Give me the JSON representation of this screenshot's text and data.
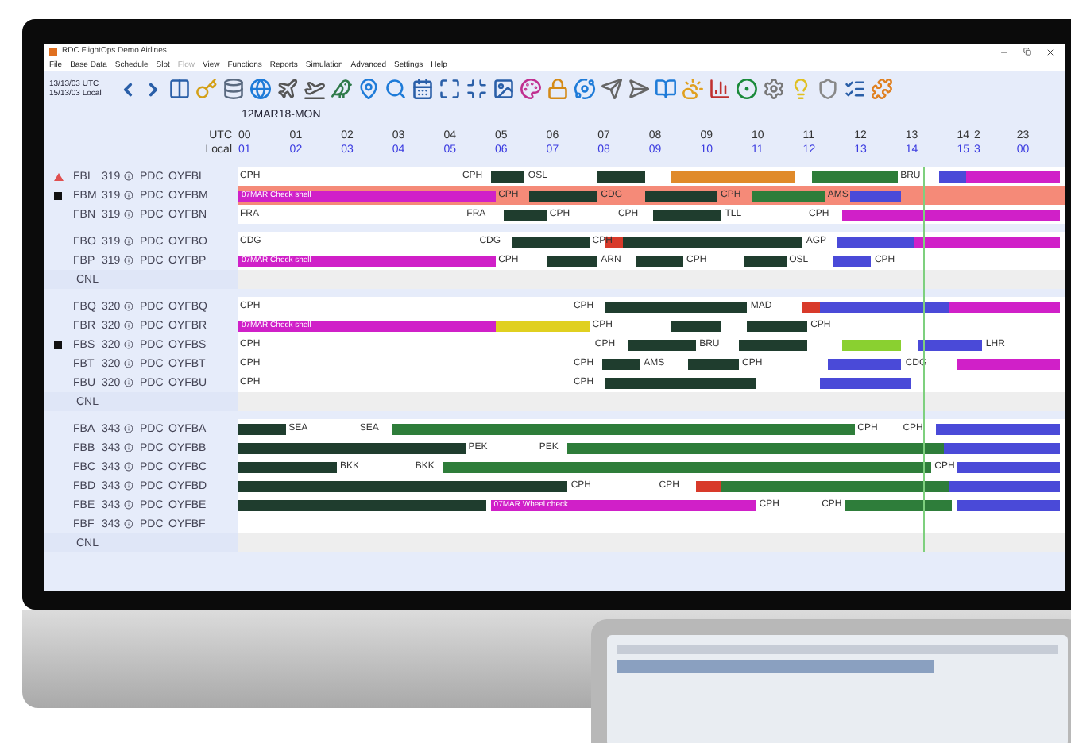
{
  "window": {
    "title": "RDC FlightOps Demo Airlines"
  },
  "menu": [
    {
      "label": "File",
      "disabled": false
    },
    {
      "label": "Base Data",
      "disabled": false
    },
    {
      "label": "Schedule",
      "disabled": false
    },
    {
      "label": "Slot",
      "disabled": false
    },
    {
      "label": "Flow",
      "disabled": true
    },
    {
      "label": "View",
      "disabled": false
    },
    {
      "label": "Functions",
      "disabled": false
    },
    {
      "label": "Reports",
      "disabled": false
    },
    {
      "label": "Simulation",
      "disabled": false
    },
    {
      "label": "Advanced",
      "disabled": false
    },
    {
      "label": "Settings",
      "disabled": false
    },
    {
      "label": "Help",
      "disabled": false
    }
  ],
  "clock": {
    "utc": "13/13/03 UTC",
    "local": "15/13/03 Local"
  },
  "date": "12MAR18-MON",
  "timeline": {
    "utc_label": "UTC",
    "local_label": "Local",
    "ticks": [
      {
        "utc": "00",
        "local": "01"
      },
      {
        "utc": "01",
        "local": "02"
      },
      {
        "utc": "02",
        "local": "03"
      },
      {
        "utc": "03",
        "local": "04"
      },
      {
        "utc": "04",
        "local": "05"
      },
      {
        "utc": "05",
        "local": "06"
      },
      {
        "utc": "06",
        "local": "07"
      },
      {
        "utc": "07",
        "local": "08"
      },
      {
        "utc": "08",
        "local": "09"
      },
      {
        "utc": "09",
        "local": "10"
      },
      {
        "utc": "10",
        "local": "11"
      },
      {
        "utc": "11",
        "local": "12"
      },
      {
        "utc": "12",
        "local": "13"
      },
      {
        "utc": "13",
        "local": "14"
      },
      {
        "utc": "14",
        "local": "15"
      },
      {
        "utc": "2",
        "local": "3"
      },
      {
        "utc": "23",
        "local": "00"
      }
    ]
  },
  "groups": [
    {
      "rows": [
        {
          "kind": "aircraft",
          "reg": "FBL",
          "type": "319",
          "base": "PDC",
          "code": "OYFBL",
          "alert": true,
          "flag": false,
          "highlight": false,
          "segments": [
            {
              "color": "#1f3d2e"
            },
            {
              "color": "#1f3d2e"
            },
            {
              "color": "#e08a2a"
            },
            {
              "color": "#2e7d3a"
            },
            {
              "color": "#4a4ad8"
            },
            {
              "color": "#d020c8"
            }
          ],
          "stations": [
            "CPH",
            "CPH",
            "OSL",
            "BRU"
          ]
        },
        {
          "kind": "aircraft",
          "reg": "FBM",
          "type": "319",
          "base": "PDC",
          "code": "OYFBM",
          "alert": false,
          "flag": true,
          "highlight": true,
          "segments": [
            {
              "color": "#d020c8",
              "text": "07MAR Check shell"
            },
            {
              "color": "#1f3d2e"
            },
            {
              "color": "#1f3d2e"
            },
            {
              "color": "#2e7d3a"
            },
            {
              "color": "#4a4ad8"
            }
          ],
          "stations": [
            "CPH",
            "CDG",
            "CPH",
            "AMS"
          ]
        },
        {
          "kind": "aircraft",
          "reg": "FBN",
          "type": "319",
          "base": "PDC",
          "code": "OYFBN",
          "alert": false,
          "flag": false,
          "highlight": false,
          "segments": [
            {
              "color": "#1f3d2e"
            },
            {
              "color": "#1f3d2e"
            },
            {
              "color": "#d020c8"
            }
          ],
          "stations": [
            "FRA",
            "FRA",
            "CPH",
            "CPH",
            "TLL",
            "CPH"
          ]
        }
      ]
    },
    {
      "rows": [
        {
          "kind": "aircraft",
          "reg": "FBO",
          "type": "319",
          "base": "PDC",
          "code": "OYFBO",
          "alert": false,
          "flag": false,
          "highlight": false,
          "segments": [
            {
              "color": "#1f3d2e"
            },
            {
              "color": "#d83a2a"
            },
            {
              "color": "#1f3d2e"
            },
            {
              "color": "#4a4ad8"
            },
            {
              "color": "#d020c8"
            }
          ],
          "stations": [
            "CDG",
            "CDG",
            "CPH",
            "AGP"
          ]
        },
        {
          "kind": "aircraft",
          "reg": "FBP",
          "type": "319",
          "base": "PDC",
          "code": "OYFBP",
          "alert": false,
          "flag": false,
          "highlight": false,
          "segments": [
            {
              "color": "#d020c8",
              "text": "07MAR Check shell"
            },
            {
              "color": "#1f3d2e"
            },
            {
              "color": "#1f3d2e"
            },
            {
              "color": "#1f3d2e"
            },
            {
              "color": "#4a4ad8"
            }
          ],
          "stations": [
            "CPH",
            "ARN",
            "CPH",
            "OSL",
            "CPH"
          ]
        },
        {
          "kind": "cancelled",
          "label": "CNL"
        }
      ]
    },
    {
      "rows": [
        {
          "kind": "aircraft",
          "reg": "FBQ",
          "type": "320",
          "base": "PDC",
          "code": "OYFBQ",
          "alert": false,
          "flag": false,
          "highlight": false,
          "segments": [
            {
              "color": "#1f3d2e"
            },
            {
              "color": "#d83a2a"
            },
            {
              "color": "#4a4ad8"
            },
            {
              "color": "#d020c8"
            }
          ],
          "stations": [
            "CPH",
            "CPH",
            "MAD"
          ]
        },
        {
          "kind": "aircraft",
          "reg": "FBR",
          "type": "320",
          "base": "PDC",
          "code": "OYFBR",
          "alert": false,
          "flag": false,
          "highlight": false,
          "segments": [
            {
              "color": "#d020c8",
              "text": "07MAR Check shell"
            },
            {
              "color": "#e0d020"
            },
            {
              "color": "#1f3d2e"
            },
            {
              "color": "#1f3d2e"
            }
          ],
          "stations": [
            "CPH",
            "CPH"
          ]
        },
        {
          "kind": "aircraft",
          "reg": "FBS",
          "type": "320",
          "base": "PDC",
          "code": "OYFBS",
          "alert": false,
          "flag": true,
          "highlight": false,
          "segments": [
            {
              "color": "#1f3d2e"
            },
            {
              "color": "#1f3d2e"
            },
            {
              "color": "#8ad030"
            },
            {
              "color": "#4a4ad8"
            }
          ],
          "stations": [
            "CPH",
            "CPH",
            "BRU",
            "LHR"
          ]
        },
        {
          "kind": "aircraft",
          "reg": "FBT",
          "type": "320",
          "base": "PDC",
          "code": "OYFBT",
          "alert": false,
          "flag": false,
          "highlight": false,
          "segments": [
            {
              "color": "#1f3d2e"
            },
            {
              "color": "#1f3d2e"
            },
            {
              "color": "#4a4ad8"
            },
            {
              "color": "#d020c8"
            }
          ],
          "stations": [
            "CPH",
            "CPH",
            "AMS",
            "CPH",
            "CDG"
          ]
        },
        {
          "kind": "aircraft",
          "reg": "FBU",
          "type": "320",
          "base": "PDC",
          "code": "OYFBU",
          "alert": false,
          "flag": false,
          "highlight": false,
          "segments": [
            {
              "color": "#1f3d2e"
            },
            {
              "color": "#4a4ad8"
            }
          ],
          "stations": [
            "CPH",
            "CPH"
          ]
        },
        {
          "kind": "cancelled",
          "label": "CNL"
        }
      ]
    },
    {
      "rows": [
        {
          "kind": "aircraft",
          "reg": "FBA",
          "type": "343",
          "base": "PDC",
          "code": "OYFBA",
          "alert": false,
          "flag": false,
          "highlight": false,
          "segments": [
            {
              "color": "#1f3d2e"
            },
            {
              "color": "#2e7d3a"
            },
            {
              "color": "#4a4ad8"
            }
          ],
          "stations": [
            "SEA",
            "SEA",
            "CPH",
            "CPH"
          ]
        },
        {
          "kind": "aircraft",
          "reg": "FBB",
          "type": "343",
          "base": "PDC",
          "code": "OYFBB",
          "alert": false,
          "flag": false,
          "highlight": false,
          "segments": [
            {
              "color": "#1f3d2e"
            },
            {
              "color": "#2e7d3a"
            },
            {
              "color": "#4a4ad8"
            }
          ],
          "stations": [
            "PEK",
            "PEK"
          ]
        },
        {
          "kind": "aircraft",
          "reg": "FBC",
          "type": "343",
          "base": "PDC",
          "code": "OYFBC",
          "alert": false,
          "flag": false,
          "highlight": false,
          "segments": [
            {
              "color": "#1f3d2e"
            },
            {
              "color": "#2e7d3a"
            },
            {
              "color": "#4a4ad8"
            }
          ],
          "stations": [
            "BKK",
            "BKK",
            "CPH"
          ]
        },
        {
          "kind": "aircraft",
          "reg": "FBD",
          "type": "343",
          "base": "PDC",
          "code": "OYFBD",
          "alert": false,
          "flag": false,
          "highlight": false,
          "segments": [
            {
              "color": "#1f3d2e"
            },
            {
              "color": "#d83a2a"
            },
            {
              "color": "#2e7d3a"
            },
            {
              "color": "#4a4ad8"
            }
          ],
          "stations": [
            "CPH",
            "CPH"
          ]
        },
        {
          "kind": "aircraft",
          "reg": "FBE",
          "type": "343",
          "base": "PDC",
          "code": "OYFBE",
          "alert": false,
          "flag": false,
          "highlight": false,
          "segments": [
            {
              "color": "#1f3d2e"
            },
            {
              "color": "#d020c8",
              "text": "07MAR Wheel check"
            },
            {
              "color": "#2e7d3a"
            },
            {
              "color": "#4a4ad8"
            }
          ],
          "stations": [
            "CPH",
            "CPH"
          ]
        },
        {
          "kind": "aircraft",
          "reg": "FBF",
          "type": "343",
          "base": "PDC",
          "code": "OYFBF",
          "alert": false,
          "flag": false,
          "highlight": false,
          "segments": [],
          "stations": []
        },
        {
          "kind": "cancelled",
          "label": "CNL"
        }
      ]
    }
  ]
}
